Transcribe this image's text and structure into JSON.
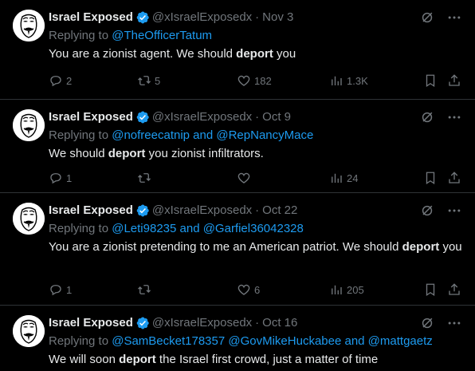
{
  "account": {
    "name": "Israel Exposed",
    "handle": "@xIsraelExposedx"
  },
  "icons": {
    "avatar": "guy-fawkes-mask-avatar",
    "verified": "verified-badge-icon",
    "grok": "grok-icon",
    "more": "more-icon",
    "reply": "reply-icon",
    "retweet": "retweet-icon",
    "like": "heart-icon",
    "views": "analytics-icon",
    "bookmark": "bookmark-icon",
    "share": "share-icon"
  },
  "colors": {
    "background": "#000000",
    "text": "#e7e9ea",
    "muted": "#71767b",
    "link": "#1d9bf0",
    "divider": "#2f3336"
  },
  "tweets": [
    {
      "date": "Nov 3",
      "replying_prefix": "Replying to",
      "replying_to": "@TheOfficerTatum",
      "text_before": "You are a zionist agent. We should ",
      "text_bold": "deport",
      "text_after": " you",
      "replies": "2",
      "retweets": "5",
      "likes": "182",
      "views": "1.3K"
    },
    {
      "date": "Oct 9",
      "replying_prefix": "Replying to",
      "replying_to": "@nofreecatnip and @RepNancyMace",
      "text_before": "We should ",
      "text_bold": "deport",
      "text_after": " you zionist infiltrators.",
      "replies": "1",
      "retweets": "",
      "likes": "",
      "views": "24"
    },
    {
      "date": "Oct 22",
      "replying_prefix": "Replying to",
      "replying_to": "@Leti98235 and @Garfiel36042328",
      "text_before": "You are a zionist pretending to me an American patriot. We should ",
      "text_bold": "deport",
      "text_after": " you",
      "replies": "1",
      "retweets": "",
      "likes": "6",
      "views": "205"
    },
    {
      "date": "Oct 16",
      "replying_prefix": "Replying to",
      "replying_to": "@SamBecket178357 @GovMikeHuckabee and @mattgaetz",
      "text_before": "We will soon ",
      "text_bold": "deport",
      "text_after": " the Israel first crowd, just a matter of time"
    }
  ]
}
